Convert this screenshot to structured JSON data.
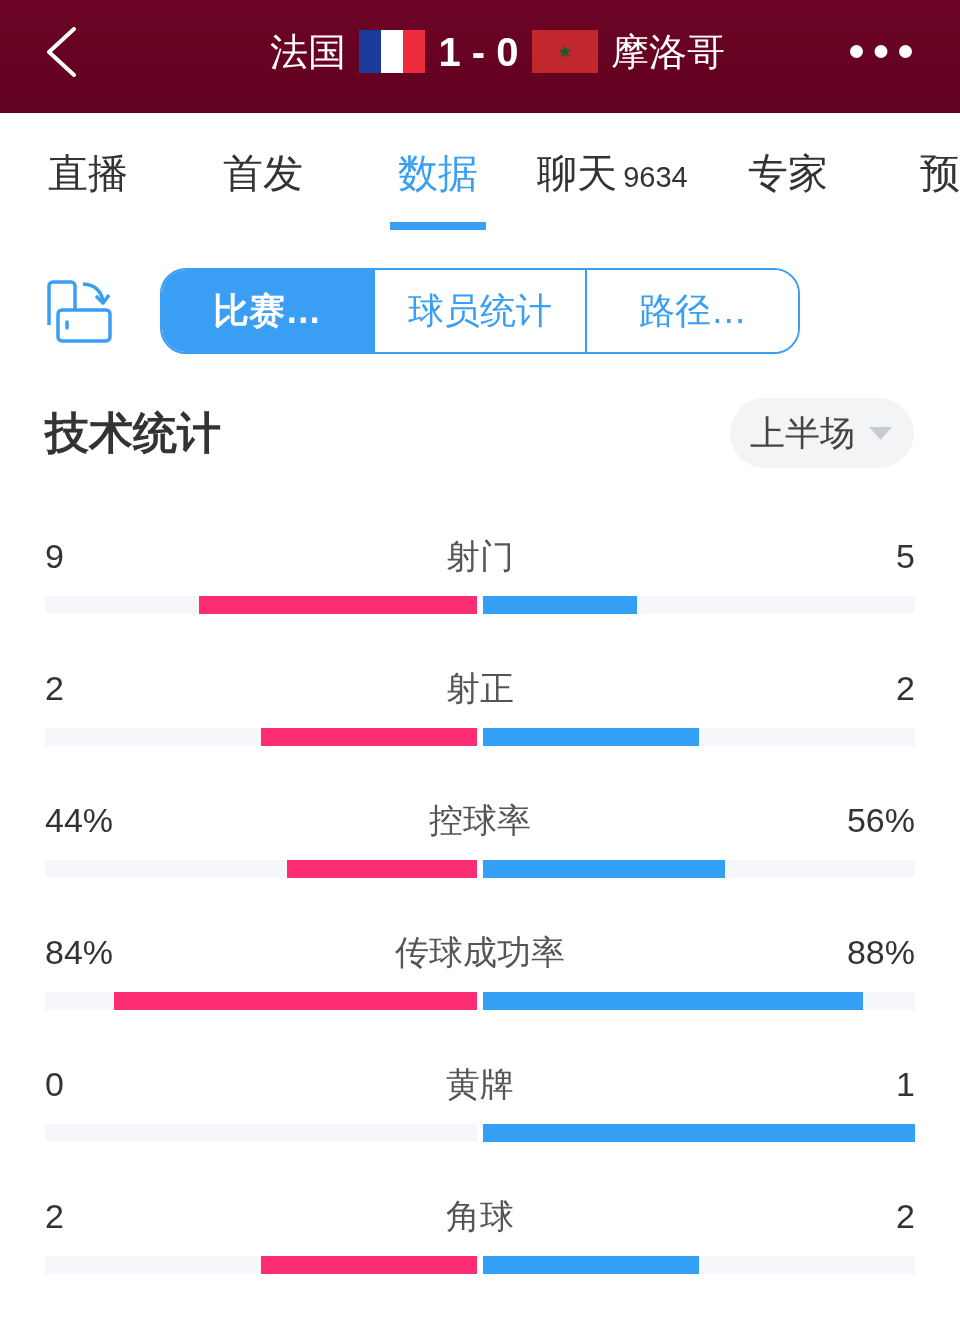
{
  "header": {
    "home_team": "法国",
    "score": "1 - 0",
    "away_team": "摩洛哥"
  },
  "tabs": [
    {
      "label": "直播",
      "selected": false
    },
    {
      "label": "首发",
      "selected": false
    },
    {
      "label": "数据",
      "selected": true
    },
    {
      "label": "聊天",
      "count": "9634",
      "selected": false
    },
    {
      "label": "专家",
      "selected": false
    },
    {
      "label": "预",
      "selected": false
    }
  ],
  "segments": [
    {
      "label": "比赛…",
      "selected": true
    },
    {
      "label": "球员统计",
      "selected": false
    },
    {
      "label": "路径…",
      "selected": false
    }
  ],
  "section": {
    "title": "技术统计",
    "period": "上半场"
  },
  "stats": [
    {
      "label": "射门",
      "home": {
        "value": "9",
        "level": 0.643
      },
      "away": {
        "value": "5",
        "level": 0.357
      }
    },
    {
      "label": "射正",
      "home": {
        "value": "2",
        "level": 0.5
      },
      "away": {
        "value": "2",
        "level": 0.5
      }
    },
    {
      "label": "控球率",
      "home": {
        "value": "44%",
        "level": 0.44
      },
      "away": {
        "value": "56%",
        "level": 0.56
      }
    },
    {
      "label": "传球成功率",
      "home": {
        "value": "84%",
        "level": 0.84
      },
      "away": {
        "value": "88%",
        "level": 0.88
      }
    },
    {
      "label": "黄牌",
      "home": {
        "value": "0",
        "level": 0
      },
      "away": {
        "value": "1",
        "level": 1
      }
    },
    {
      "label": "角球",
      "home": {
        "value": "2",
        "level": 0.5
      },
      "away": {
        "value": "2",
        "level": 0.5
      }
    }
  ]
}
